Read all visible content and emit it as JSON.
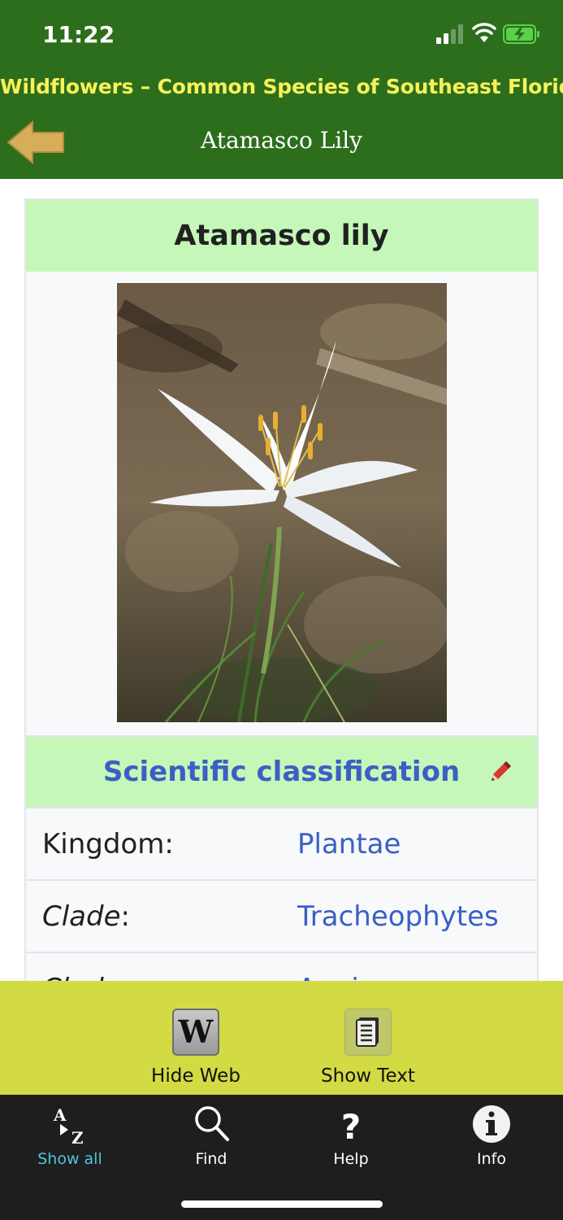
{
  "status_bar": {
    "time": "11:22",
    "icons": [
      "cellular-signal-icon",
      "wifi-icon",
      "battery-charging-icon"
    ]
  },
  "header": {
    "app_title": "Wildflowers – Common Species of Southeast Florida",
    "page_title": "Atamasco Lily",
    "back_icon": "back-arrow-icon",
    "background": "#2d6e1c",
    "title_color": "#f7f15a"
  },
  "infobox": {
    "title": "Atamasco lily",
    "image_subject": "white atamasco lily flower",
    "classification_title": "Scientific classification",
    "edit_icon": "pencil-icon",
    "rows": [
      {
        "label": "Kingdom",
        "italic": false,
        "value": "Plantae"
      },
      {
        "label": "Clade",
        "italic": true,
        "value": "Tracheophytes"
      },
      {
        "label": "Clade",
        "italic": true,
        "value": "Angiosperms"
      }
    ],
    "header_bg": "#c5f7b8",
    "link_color": "#3a5fc6"
  },
  "toolbar": {
    "hide_web_label": "Hide Web",
    "show_text_label": "Show Text",
    "background": "#d2da44"
  },
  "tabs": [
    {
      "label": "Show all",
      "icon": "a-to-z-icon",
      "active": true
    },
    {
      "label": "Find",
      "icon": "search-icon",
      "active": false
    },
    {
      "label": "Help",
      "icon": "question-icon",
      "active": false
    },
    {
      "label": "Info",
      "icon": "info-icon",
      "active": false
    }
  ]
}
